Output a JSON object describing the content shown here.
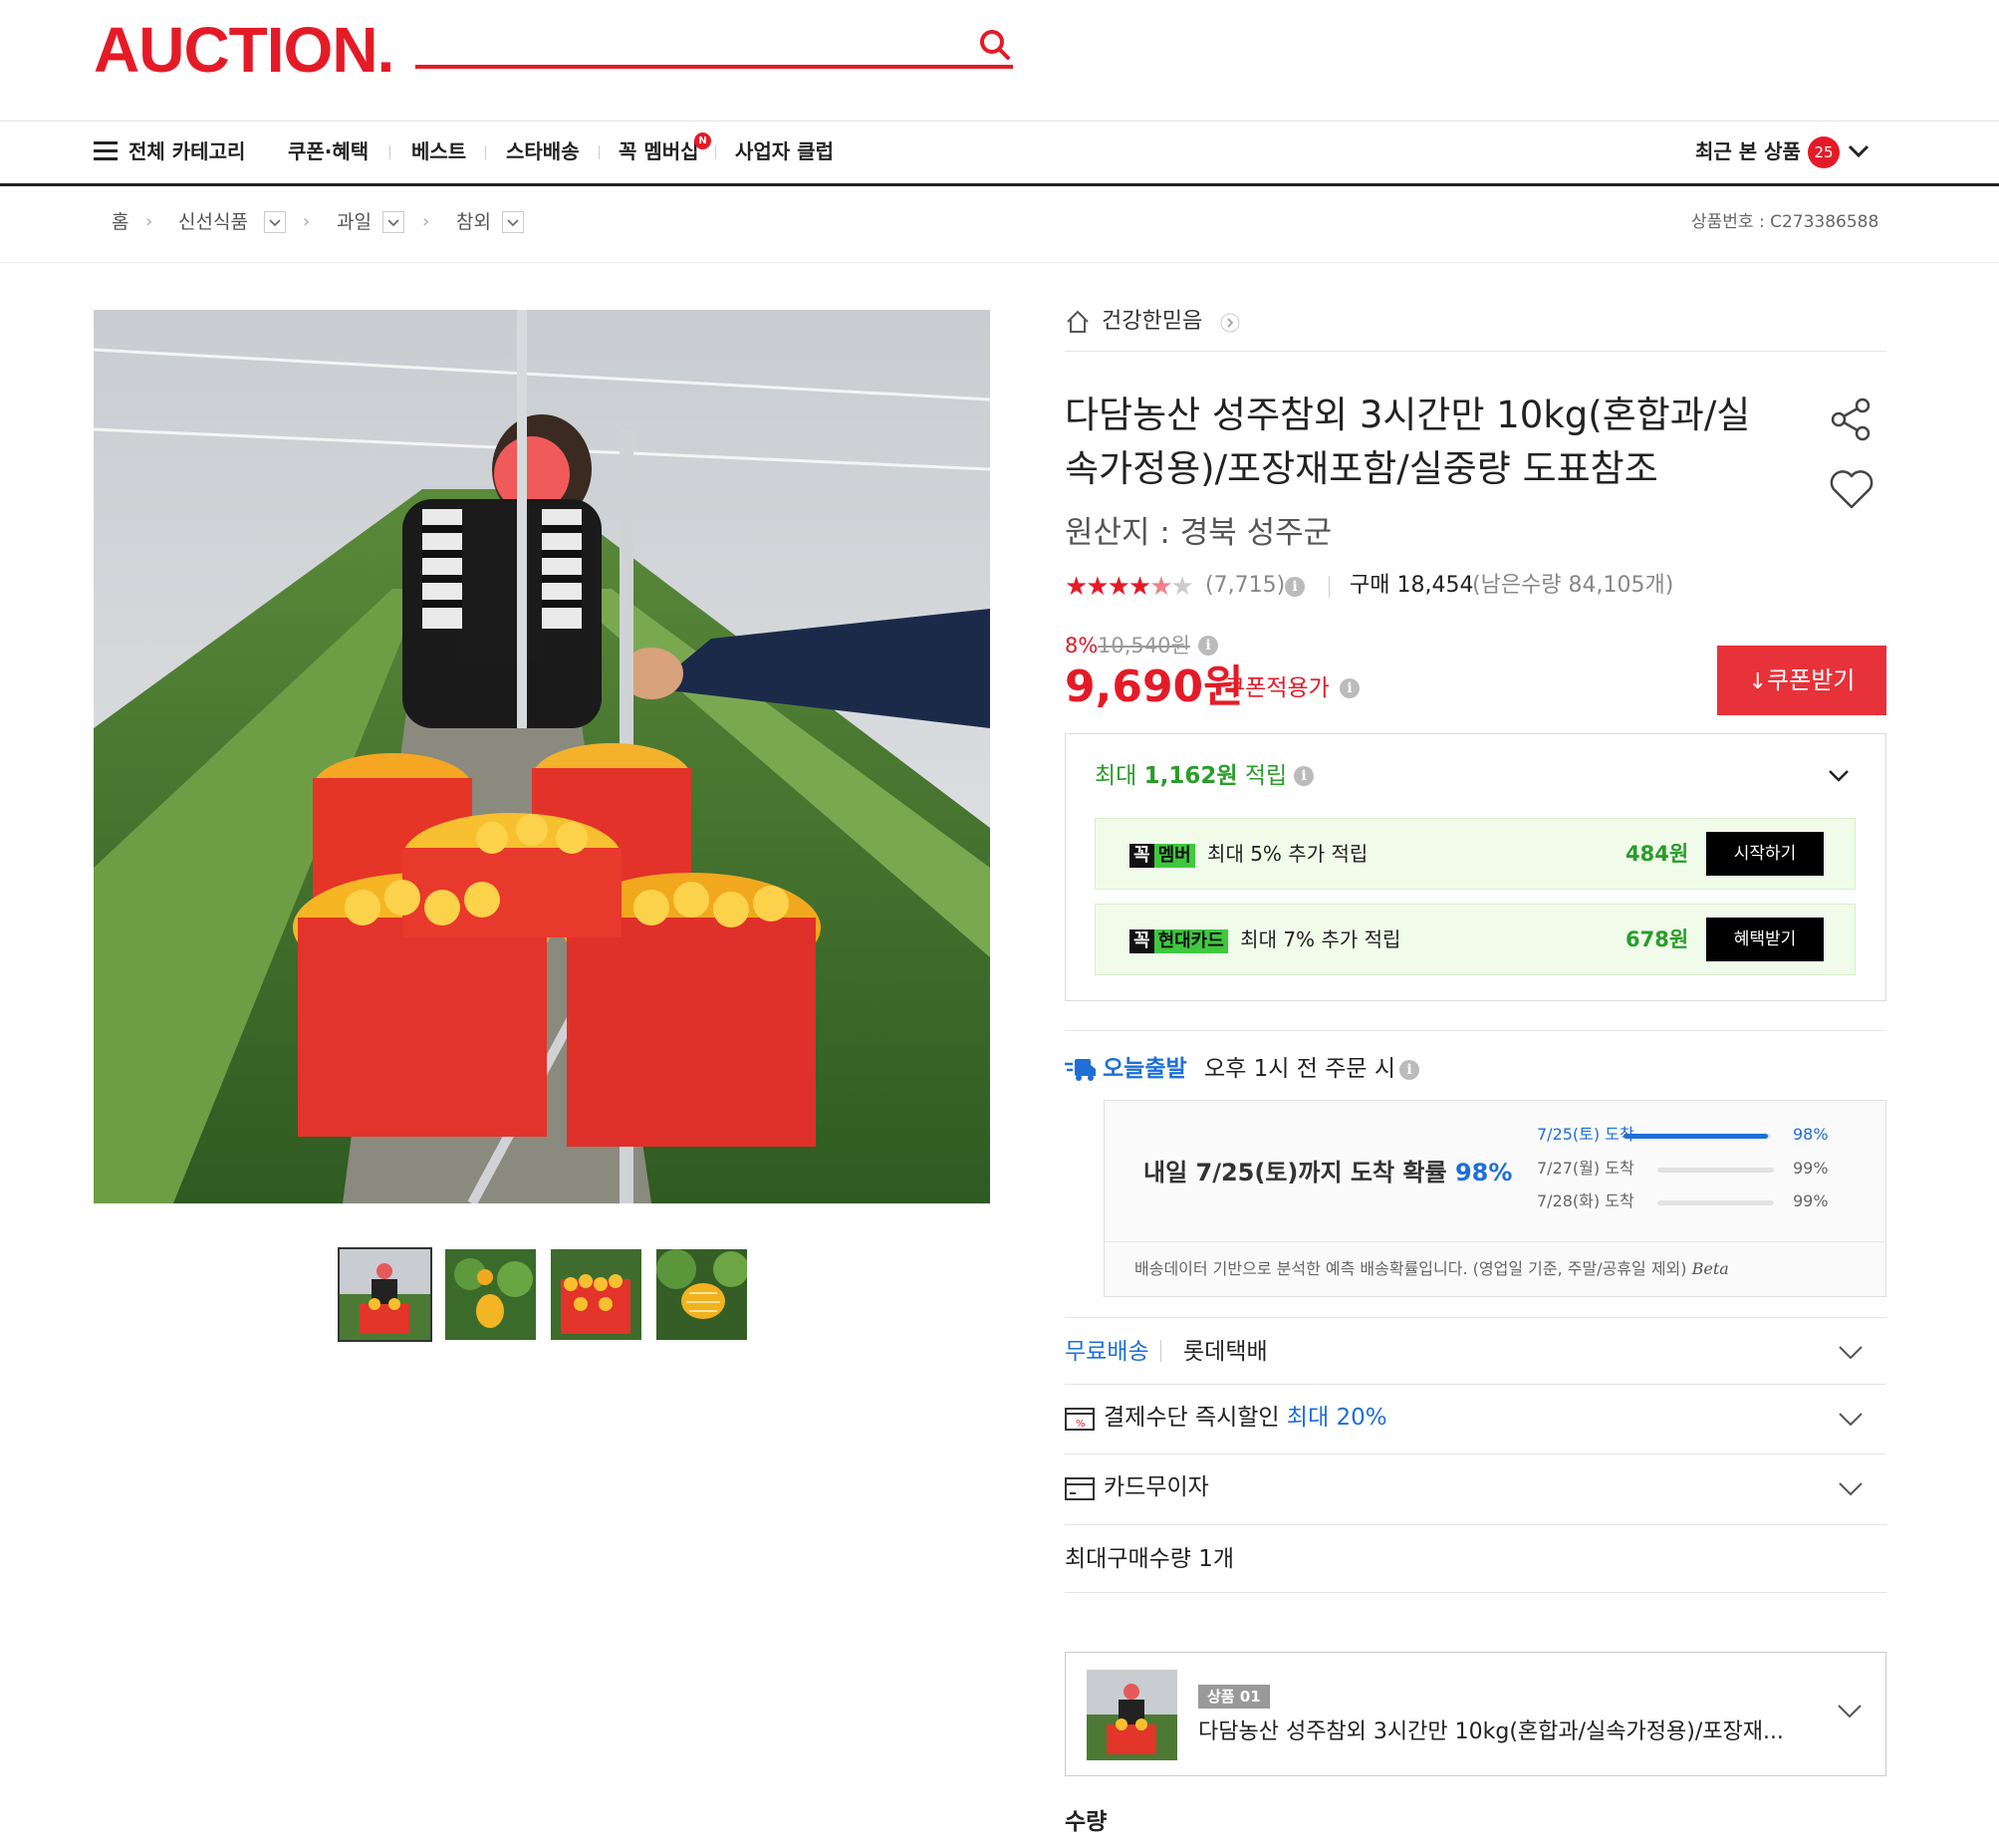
{
  "header": {
    "logo": "AUCTION.",
    "search_placeholder": ""
  },
  "nav": {
    "all_categories": "전체 카테고리",
    "items": [
      "쿠폰·혜택",
      "베스트",
      "스타배송",
      "꼭 멤버십",
      "사업자 클럽"
    ],
    "new_badge": "N",
    "recent_label": "최근 본 상품",
    "recent_count": "25"
  },
  "breadcrumb": {
    "items": [
      "홈",
      "신선식품",
      "과일",
      "참외"
    ],
    "product_no": "상품번호 : C273386588"
  },
  "seller": {
    "name": "건강한믿음"
  },
  "product": {
    "title": "다담농산 성주참외 3시간만 10kg(혼합과/실속가정용)/포장재포함/실중량 도표참조",
    "origin": "원산지 : 경북 성주군",
    "rating_stars": 4.5,
    "review_count": "(7,715)",
    "purchase_label": "구매 18,454",
    "remaining": "(남은수량 84,105개)",
    "discount_rate": "8%",
    "original_price": "10,540원",
    "price": "9,690원",
    "price_note": "쿠폰적용가",
    "coupon_button": "쿠폰받기"
  },
  "points": {
    "headline_prefix": "최대 ",
    "headline_amount": "1,162원",
    "headline_suffix": " 적립",
    "rows": [
      {
        "tag1": "꼭",
        "tag2": "멤버",
        "text": "최대 5% 추가 적립",
        "amount": "484원",
        "button": "시작하기"
      },
      {
        "tag1": "꼭",
        "tag2": "현대카드",
        "text": "최대 7% 추가 적립",
        "amount": "678원",
        "button": "혜택받기"
      }
    ]
  },
  "shipping": {
    "today_label": "오늘출발",
    "today_text": "오후 1시 전 주문 시",
    "headline": "내일 7/25(토)까지 도착 확률",
    "headline_pct": "98%",
    "rows": [
      {
        "label": "7/25(토) 도착",
        "pct": "98%",
        "fill": 0.98
      },
      {
        "label": "7/27(월) 도착",
        "pct": "99%",
        "fill": 0
      },
      {
        "label": "7/28(화) 도착",
        "pct": "99%",
        "fill": 0
      }
    ],
    "note": "배송데이터 기반으로 분석한 예측 배송확률입니다. (영업일 기준, 주말/공휴일 제외)",
    "beta": "Beta"
  },
  "options": {
    "free_ship": "무료배송",
    "courier": "롯데택배",
    "instant_discount": "결제수단 즉시할인",
    "instant_max": "최대 20%",
    "card_interest": "카드무이자",
    "max_qty": "최대구매수량 1개"
  },
  "selected_item": {
    "badge": "상품 01",
    "name": "다담농산 성주참외 3시간만 10kg(혼합과/실속가정용)/포장재..."
  },
  "quantity_label": "수량",
  "colors": {
    "brand": "#e41b27",
    "blue": "#1e6fd9",
    "green": "#2a9d2a"
  }
}
